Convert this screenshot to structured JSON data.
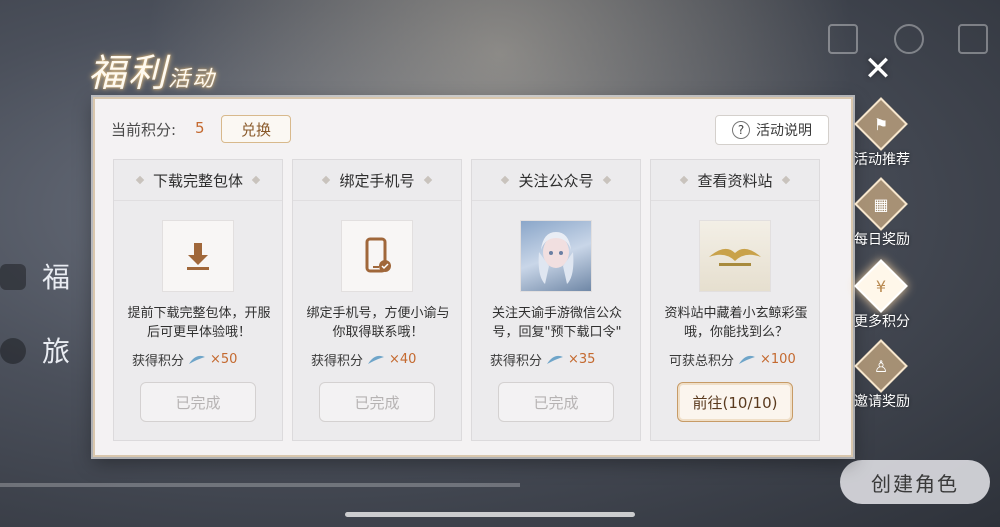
{
  "title": {
    "main": "福利",
    "sub": "活动"
  },
  "header": {
    "points_label": "当前积分:",
    "points_value": "5",
    "exchange_label": "兑换",
    "help_label": "活动说明"
  },
  "cards": [
    {
      "title": "下载完整包体",
      "icon": "download-icon",
      "desc": "提前下载完整包体，开服后可更早体验哦！",
      "reward_label": "获得积分",
      "reward_value": "×50",
      "button": "已完成",
      "state": "done"
    },
    {
      "title": "绑定手机号",
      "icon": "phone-icon",
      "desc": "绑定手机号，方便小谕与你取得联系哦！",
      "reward_label": "获得积分",
      "reward_value": "×40",
      "button": "已完成",
      "state": "done"
    },
    {
      "title": "关注公众号",
      "icon": "character-portrait",
      "desc": "关注天谕手游微信公众号，回复\"预下载口令\"",
      "reward_label": "获得积分",
      "reward_value": "×35",
      "button": "已完成",
      "state": "done"
    },
    {
      "title": "查看资料站",
      "icon": "game-logo",
      "desc": "资料站中藏着小玄鲸彩蛋哦，你能找到么？",
      "reward_label": "可获总积分",
      "reward_value": "×100",
      "button": "前往(10/10)",
      "state": "go"
    }
  ],
  "side_nav": [
    {
      "label": "活动推荐",
      "icon": "flag-icon",
      "active": false
    },
    {
      "label": "每日奖励",
      "icon": "calendar-icon",
      "active": false
    },
    {
      "label": "更多积分",
      "icon": "money-bag-icon",
      "active": true
    },
    {
      "label": "邀请奖励",
      "icon": "user-add-icon",
      "active": false
    }
  ],
  "background": {
    "create_role_label": "创建角色"
  },
  "colors": {
    "accent": "#c4692f",
    "panel_bg": "#f4f2f3",
    "border_gold": "#d9c7ad"
  }
}
